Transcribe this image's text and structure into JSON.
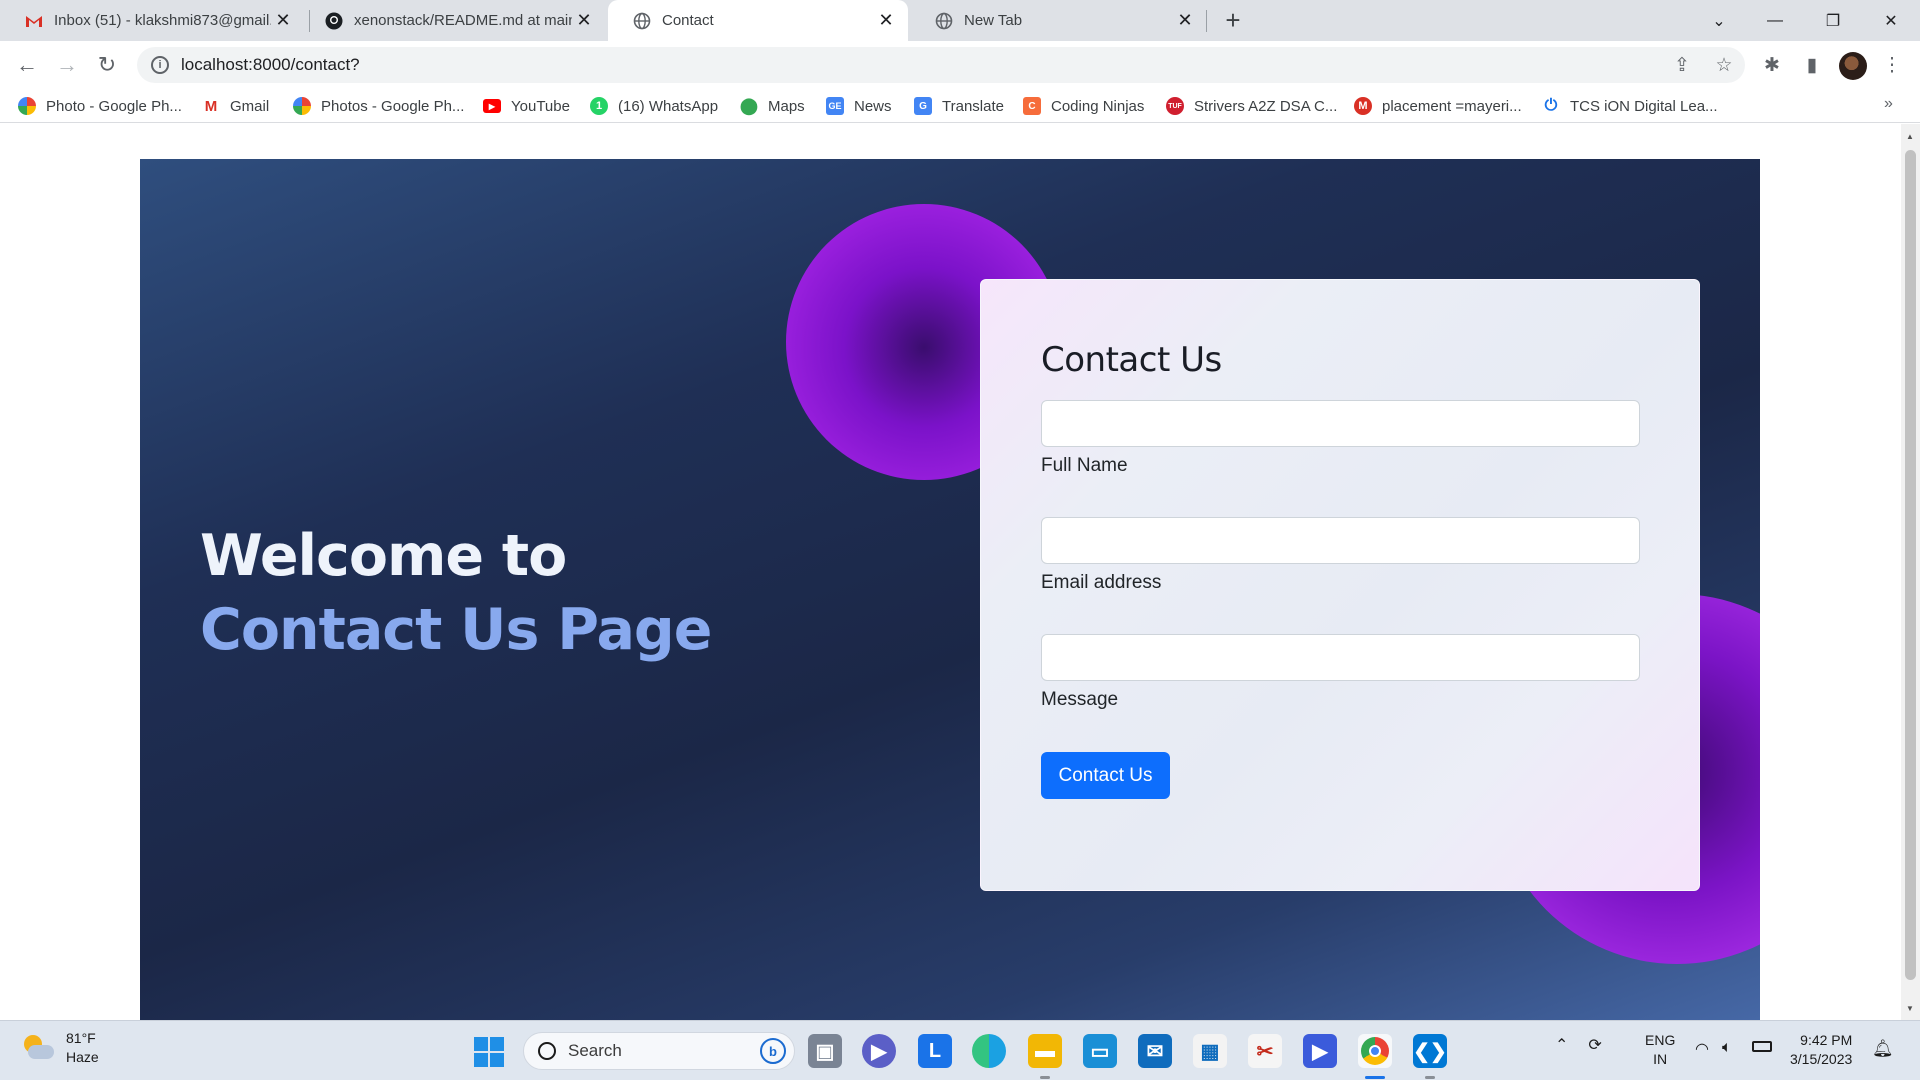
{
  "browser": {
    "tabs": [
      {
        "title": "Inbox (51) - klakshmi873@gmail.",
        "icon": "gmail-icon",
        "active": false
      },
      {
        "title": "xenonstack/README.md at main",
        "icon": "github-icon",
        "active": false
      },
      {
        "title": "Contact",
        "icon": "globe-icon",
        "active": true
      },
      {
        "title": "New Tab",
        "icon": "globe-icon",
        "active": false
      }
    ],
    "url": "localhost:8000/contact?",
    "bookmarks": [
      {
        "label": "Photo - Google Ph...",
        "icon": "google-photos-icon"
      },
      {
        "label": "Gmail",
        "icon": "gmail-icon"
      },
      {
        "label": "Photos - Google Ph...",
        "icon": "google-photos-icon"
      },
      {
        "label": "YouTube",
        "icon": "youtube-icon"
      },
      {
        "label": "(16) WhatsApp",
        "icon": "whatsapp-icon"
      },
      {
        "label": "Maps",
        "icon": "maps-icon"
      },
      {
        "label": "News",
        "icon": "news-icon"
      },
      {
        "label": "Translate",
        "icon": "translate-icon"
      },
      {
        "label": "Coding Ninjas",
        "icon": "coding-ninjas-icon"
      },
      {
        "label": "Strivers A2Z DSA C...",
        "icon": "tuf-icon"
      },
      {
        "label": "placement =mayeri...",
        "icon": "gmail-icon"
      },
      {
        "label": "TCS iON Digital Lea...",
        "icon": "power-icon"
      }
    ],
    "bookmarks_more": "»"
  },
  "page": {
    "welcome_line1": "Welcome to",
    "welcome_line2": "Contact Us Page",
    "form": {
      "title": "Contact Us",
      "fields": [
        {
          "label": "Full Name",
          "value": ""
        },
        {
          "label": "Email address",
          "value": ""
        },
        {
          "label": "Message",
          "value": ""
        }
      ],
      "submit_label": "Contact Us"
    },
    "colors": {
      "accent_button": "#0d6efd",
      "heading_highlight": "#88a9ee",
      "blob": "#9d21e0"
    }
  },
  "taskbar": {
    "weather": {
      "temp": "81°F",
      "condition": "Haze"
    },
    "search_placeholder": "Search",
    "lang_line1": "ENG",
    "lang_line2": "IN",
    "time": "9:42 PM",
    "date": "3/15/2023"
  }
}
